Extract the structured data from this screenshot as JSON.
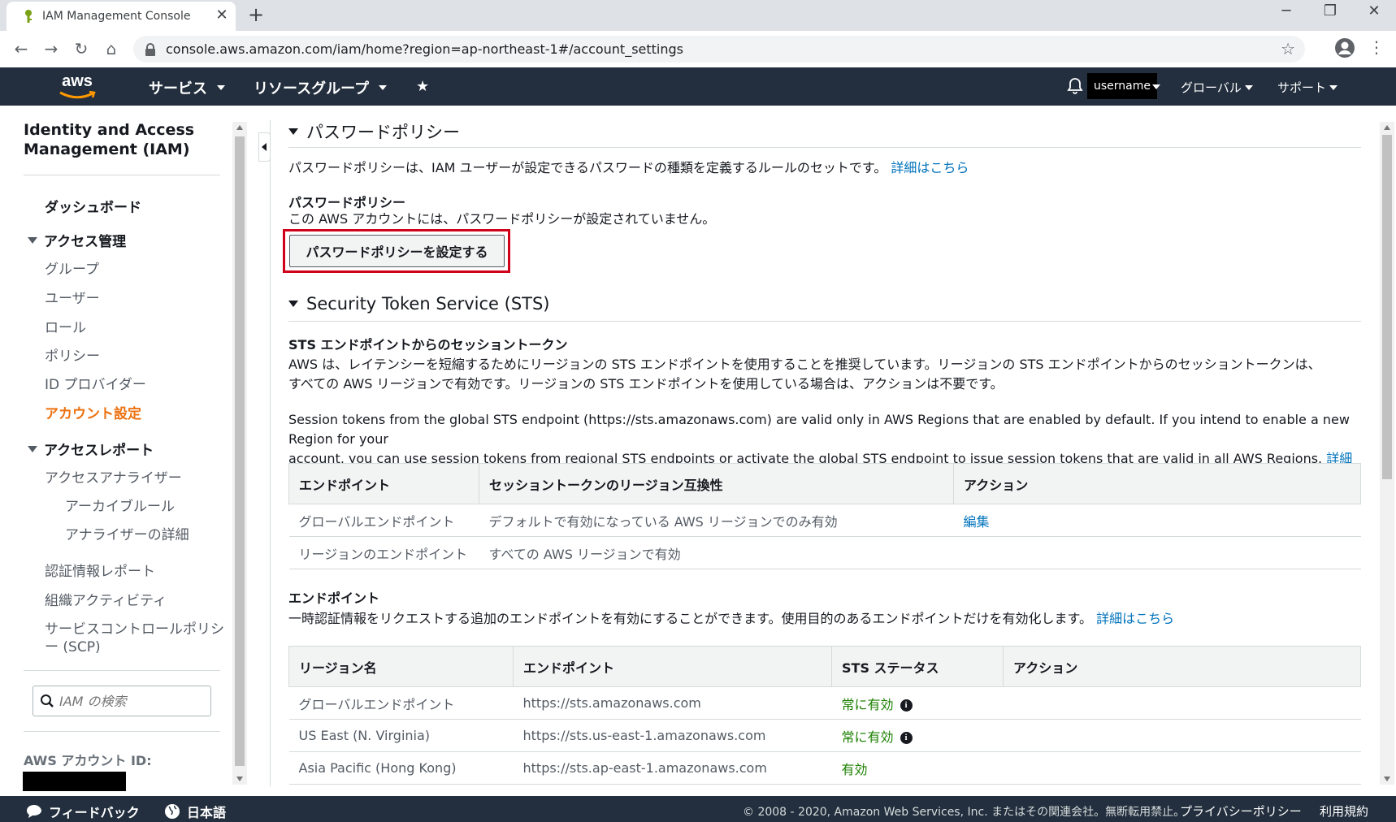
{
  "browser": {
    "tab_title": "IAM Management Console",
    "new_tab": "+",
    "url": "console.aws.amazon.com/iam/home?region=ap-northeast-1#/account_settings",
    "minimize": "─",
    "maximize": "❐",
    "close": "✕"
  },
  "topnav": {
    "logo": "aws",
    "services": "サービス",
    "resource_groups": "リソースグループ",
    "username": "username",
    "region": "グローバル",
    "support": "サポート"
  },
  "sidebar": {
    "title": "Identity and Access Management (IAM)",
    "dashboard": "ダッシュボード",
    "access_mgmt": "アクセス管理",
    "groups": "グループ",
    "users": "ユーザー",
    "roles": "ロール",
    "policies": "ポリシー",
    "id_providers": "ID プロバイダー",
    "account_settings": "アカウント設定",
    "access_reports": "アクセスレポート",
    "access_analyzer": "アクセスアナライザー",
    "archive_rules": "アーカイブルール",
    "analyzer_details": "アナライザーの詳細",
    "cred_report": "認証情報レポート",
    "org_activity": "組織アクティビティ",
    "scp_line1": "サービスコントロールポリシ",
    "scp_line2": "ー (SCP)",
    "search_placeholder": "IAM の検索",
    "account_id_label": "AWS アカウント ID:"
  },
  "password_policy": {
    "heading": "パスワードポリシー",
    "description": "パスワードポリシーは、IAM ユーザーが設定できるパスワードの種類を定義するルールのセットです。",
    "learn_more": "詳細はこちら",
    "subheading": "パスワードポリシー",
    "status": "この AWS アカウントには、パスワードポリシーが設定されていません。",
    "button": "パスワードポリシーを設定する"
  },
  "sts": {
    "heading": "Security Token Service (STS)",
    "subheading": "STS エンドポイントからのセッショントークン",
    "desc_ja_1": "AWS は、レイテンシーを短縮するためにリージョンの STS エンドポイントを使用することを推奨しています。リージョンの STS エンドポイントからのセッショントークンは、",
    "desc_ja_2": "すべての AWS リージョンで有効です。リージョンの STS エンドポイントを使用している場合は、アクションは不要です。",
    "desc_en_1": "Session tokens from the global STS endpoint (https://sts.amazonaws.com) are valid only in AWS Regions that are enabled by default. If you intend to enable a new Region for your",
    "desc_en_2": "account, you can use session tokens from regional STS endpoints or activate the global STS endpoint to issue session tokens that are valid in all AWS Regions.",
    "learn_more": "詳細はこちら",
    "table1": {
      "headers": [
        "エンドポイント",
        "セッショントークンのリージョン互換性",
        "アクション"
      ],
      "rows": [
        {
          "endpoint": "グローバルエンドポイント",
          "compat": "デフォルトで有効になっている AWS リージョンでのみ有効",
          "action": "編集"
        },
        {
          "endpoint": "リージョンのエンドポイント",
          "compat": "すべての AWS リージョンで有効",
          "action": ""
        }
      ]
    },
    "endpoints_heading": "エンドポイント",
    "endpoints_desc": "一時認証情報をリクエストする追加のエンドポイントを有効にすることができます。使用目的のあるエンドポイントだけを有効化します。",
    "endpoints_learn_more": "詳細はこちら",
    "table2": {
      "headers": [
        "リージョン名",
        "エンドポイント",
        "STS ステータス",
        "アクション"
      ],
      "rows": [
        {
          "region": "グローバルエンドポイント",
          "endpoint": "https://sts.amazonaws.com",
          "status": "常に有効",
          "info": true
        },
        {
          "region": "US East (N. Virginia)",
          "endpoint": "https://sts.us-east-1.amazonaws.com",
          "status": "常に有効",
          "info": true
        },
        {
          "region": "Asia Pacific (Hong Kong)",
          "endpoint": "https://sts.ap-east-1.amazonaws.com",
          "status": "有効",
          "info": false
        }
      ]
    }
  },
  "footer": {
    "feedback": "フィードバック",
    "language": "日本語",
    "copyright": "© 2008 - 2020, Amazon Web Services, Inc. またはその関連会社。無断転用禁止。",
    "privacy": "プライバシーポリシー",
    "terms": "利用規約"
  },
  "colors": {
    "nav_bg": "#232f3e",
    "link": "#0073bb",
    "active": "#ec7211",
    "status_green": "#1d8102",
    "highlight": "#d0021b"
  }
}
